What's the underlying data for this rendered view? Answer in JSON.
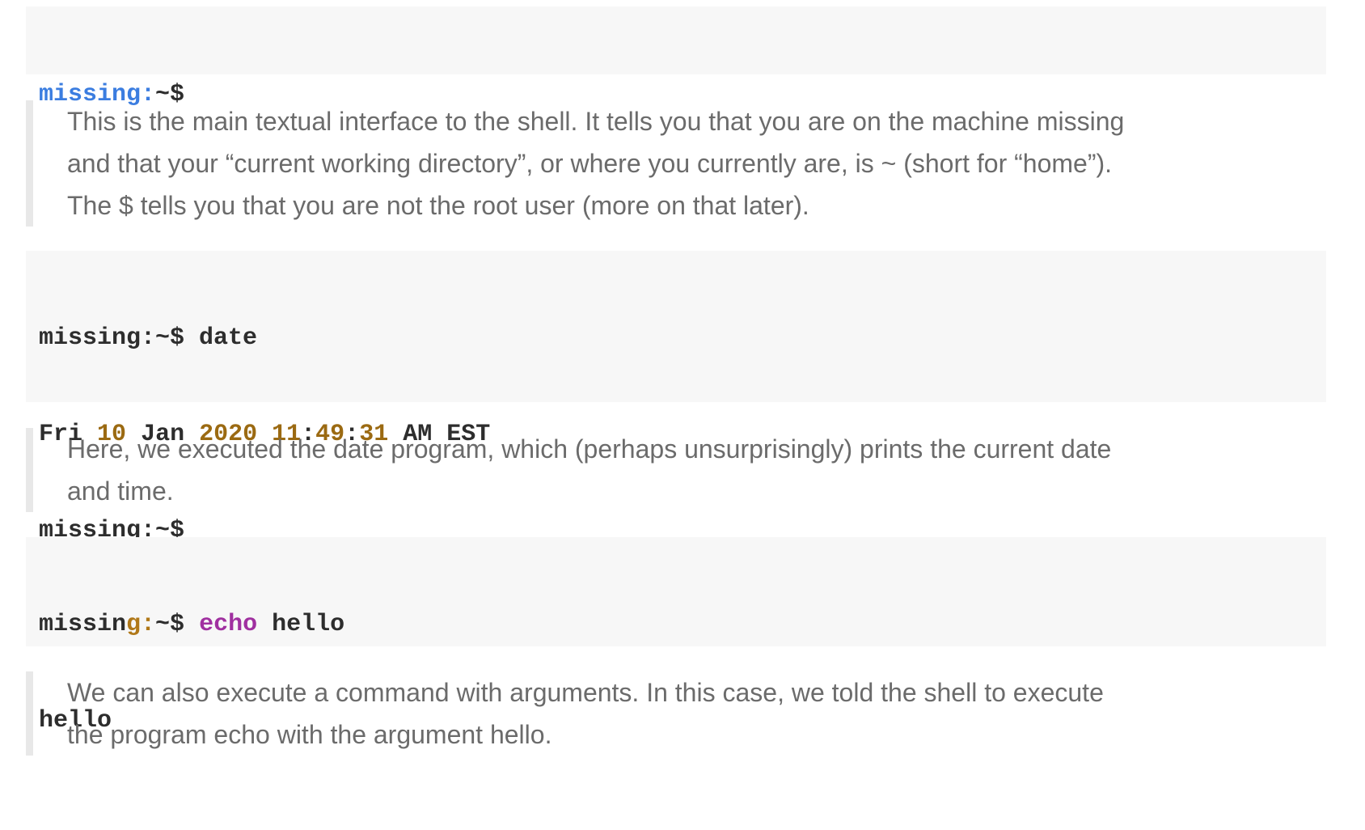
{
  "block1": {
    "prompt_host": "missing:",
    "prompt_tail": "~$"
  },
  "quote1": {
    "lines": [
      "This is the main textual interface to the shell. It tells you that you are on the machine missing",
      "and that your “current working directory”, or where you currently are, is ~ (short for “home”).",
      "The $ tells you that you are not the root user (more on that later)."
    ]
  },
  "block2": {
    "line1": "missing:~$ date",
    "line2": {
      "day": "Fri",
      "date_num": "10",
      "month": "Jan",
      "year": "2020",
      "hour": "11",
      "min": "49",
      "sec": "31",
      "ampm_tz": "AM EST"
    },
    "line3": "missing:~$"
  },
  "quote2": {
    "lines": [
      "Here, we executed the date program, which (perhaps unsurprisingly) prints the current date",
      "and time."
    ]
  },
  "block3": {
    "prompt_a": "missin",
    "prompt_b": "g:",
    "prompt_c": "~$",
    "command": "echo",
    "argument": "hello",
    "output": "hello"
  },
  "quote3": {
    "lines": [
      "We can also execute a command with arguments. In this case, we told the shell to execute",
      "the program echo with the argument hello."
    ]
  }
}
